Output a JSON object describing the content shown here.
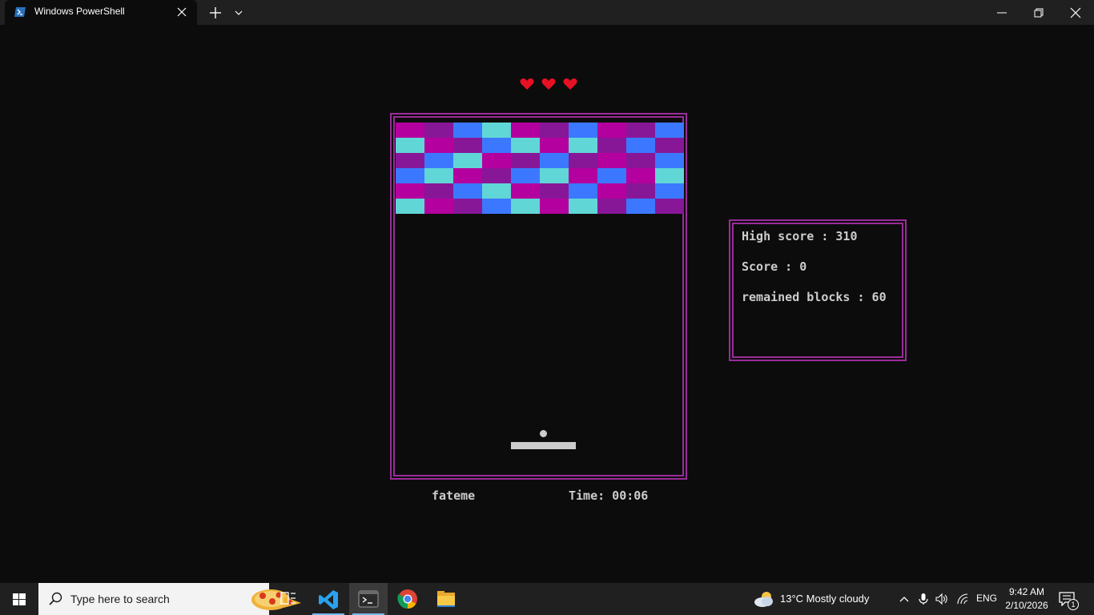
{
  "titlebar": {
    "tab_title": "Windows PowerShell",
    "icons": [
      "powershell-icon",
      "close-icon",
      "plus-icon",
      "chevron-down-icon",
      "minimize-icon",
      "restore-icon",
      "close-icon"
    ]
  },
  "game": {
    "lives": 3,
    "player_name": "fateme",
    "time": "Time: 00:06",
    "colors": {
      "border": "#9a2c9a",
      "brick_magenta": "#b4009e",
      "brick_purple": "#881798",
      "brick_blue": "#3b78ff",
      "brick_cyan": "#61d6d6",
      "heart": "#e81123"
    },
    "bricks": [
      [
        "magenta",
        "purple",
        "blue",
        "cyan",
        "magenta",
        "purple",
        "blue",
        "magenta",
        "purple",
        "blue"
      ],
      [
        "cyan",
        "magenta",
        "purple",
        "blue",
        "cyan",
        "magenta",
        "cyan",
        "purple",
        "blue",
        "purple"
      ],
      [
        "purple",
        "blue",
        "cyan",
        "magenta",
        "purple",
        "blue",
        "purple",
        "magenta",
        "purple",
        "blue"
      ],
      [
        "blue",
        "cyan",
        "magenta",
        "purple",
        "blue",
        "cyan",
        "magenta",
        "blue",
        "magenta",
        "cyan"
      ],
      [
        "magenta",
        "purple",
        "blue",
        "cyan",
        "magenta",
        "purple",
        "blue",
        "magenta",
        "purple",
        "blue"
      ],
      [
        "cyan",
        "magenta",
        "purple",
        "blue",
        "cyan",
        "magenta",
        "cyan",
        "purple",
        "blue",
        "purple"
      ]
    ]
  },
  "scoreboard": {
    "high_score": "High score : 310",
    "score": "Score : 0",
    "remained_blocks": "remained blocks : 60"
  },
  "taskbar": {
    "search_placeholder": "Type here to search",
    "weather": "13°C  Mostly cloudy",
    "language": "ENG",
    "time": "9:42 AM",
    "date": "2/10/2026",
    "notification_count": "1",
    "apps": [
      "task-view-icon",
      "vscode-icon",
      "terminal-icon",
      "chrome-icon",
      "file-explorer-icon"
    ]
  }
}
